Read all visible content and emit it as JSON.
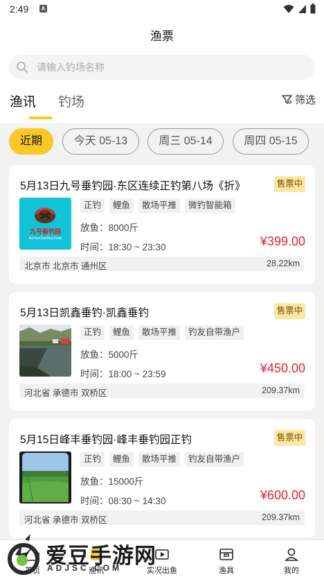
{
  "status_bar": {
    "time": "2:49",
    "notification_badge": "A"
  },
  "header": {
    "title": "渔票"
  },
  "search": {
    "placeholder": "请输入钓场名称"
  },
  "tabs": [
    {
      "label": "渔讯",
      "active": true
    },
    {
      "label": "钓场",
      "active": false
    }
  ],
  "filter_label": "筛选",
  "date_chips": [
    {
      "label": "近期",
      "active": true
    },
    {
      "label": "今天 05-13",
      "active": false
    },
    {
      "label": "周三 05-14",
      "active": false
    },
    {
      "label": "周四 05-15",
      "active": false
    }
  ],
  "cards": [
    {
      "title": "5月13日九号垂钓园·东区连续正钓第八场《折》",
      "badge": "售票中",
      "tags": [
        "正钓",
        "鲤鱼",
        "散场平推",
        "微钓智能箱"
      ],
      "fish_amount": "放鱼：8000斤",
      "time": "时间：18:30 ~ 23:30",
      "price": "¥399.00",
      "address": "北京市 北京市 通州区",
      "distance": "28.22km",
      "image_text": "九号垂钓园",
      "image_subtext": "NuHaoChuiDiaoYuan"
    },
    {
      "title": "5月13日凯鑫垂钓·凯鑫垂钓",
      "badge": "售票中",
      "tags": [
        "正钓",
        "鲤鱼",
        "散场平推",
        "钓友自带渔户"
      ],
      "fish_amount": "放鱼：5000斤",
      "time": "时间：18:00 ~ 23:59",
      "price": "¥450.00",
      "address": "河北省 承德市 双桥区",
      "distance": "209.37km"
    },
    {
      "title": "5月15日峰丰垂钓园·峰丰垂钓园正钓",
      "badge": "售票中",
      "tags": [
        "正钓",
        "鲤鱼",
        "散场平推",
        "钓友自带渔户"
      ],
      "fish_amount": "放鱼：15000斤",
      "time": "时间：08:30 ~ 14:30",
      "price": "¥600.00",
      "address": "河北省 承德市 双桥区",
      "distance": "209.37km"
    }
  ],
  "tabbar": [
    {
      "label": "首页",
      "icon": "home-icon"
    },
    {
      "label": "渔讯",
      "icon": "news-icon"
    },
    {
      "label": "实况出鱼",
      "icon": "live-icon"
    },
    {
      "label": "渔具",
      "icon": "gear-box-icon"
    },
    {
      "label": "我的",
      "icon": "user-icon"
    }
  ],
  "watermark": {
    "text": "爱豆手游网",
    "url": "ADJSC.COM"
  },
  "colors": {
    "accent": "#f7c826",
    "price": "#e8222d",
    "badge_bg": "#fbe7a1"
  }
}
